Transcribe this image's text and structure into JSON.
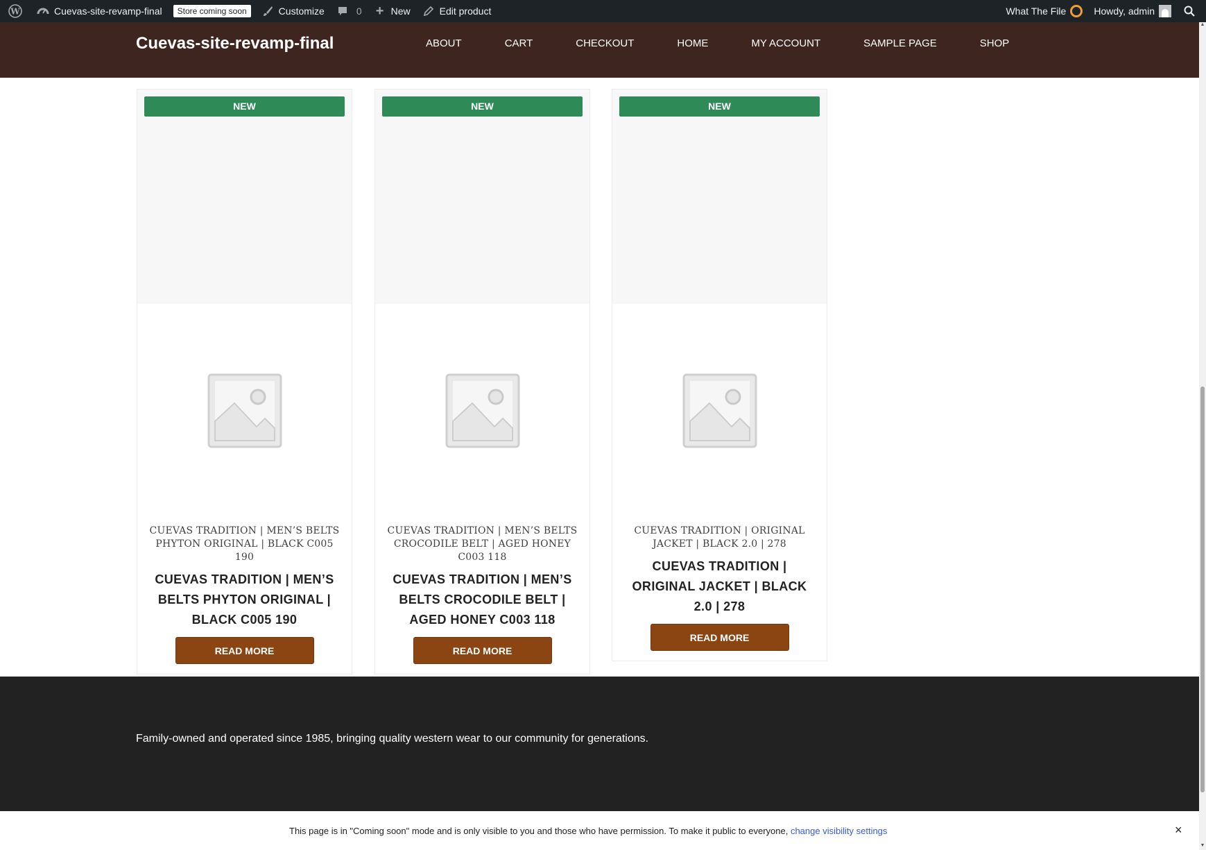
{
  "admin_bar": {
    "site_name": "Cuevas-site-revamp-final",
    "store_badge": "Store coming soon",
    "customize": "Customize",
    "comments_count": "0",
    "new": "New",
    "edit_product": "Edit product",
    "plugin": "What The File",
    "howdy": "Howdy, admin"
  },
  "header": {
    "site_title": "Cuevas-site-revamp-final",
    "nav": [
      "ABOUT",
      "CART",
      "CHECKOUT",
      "HOME",
      "MY ACCOUNT",
      "SAMPLE PAGE",
      "SHOP"
    ]
  },
  "products": [
    {
      "badge": "NEW",
      "category": "CUEVAS TRADITION | MEN’S BELTS PHYTON ORIGINAL | BLACK C005 190",
      "title": "CUEVAS TRADITION | MEN’S BELTS PHYTON ORIGINAL | BLACK C005 190",
      "button": "READ MORE"
    },
    {
      "badge": "NEW",
      "category": "CUEVAS TRADITION | MEN’S BELTS CROCODILE BELT | AGED HONEY C003 118",
      "title": "CUEVAS TRADITION | MEN’S BELTS CROCODILE BELT | AGED HONEY C003 118",
      "button": "READ MORE"
    },
    {
      "badge": "NEW",
      "category": "CUEVAS TRADITION | ORIGINAL JACKET | BLACK 2.0 | 278",
      "title": "CUEVAS TRADITION | ORIGINAL JACKET | BLACK 2.0 | 278",
      "button": "READ MORE"
    }
  ],
  "footer": {
    "text": "Family-owned and operated since 1985, bringing quality western wear to our community for generations."
  },
  "coming_soon": {
    "message": "This page is in \"Coming soon\" mode and is only visible to you and those who have permission. To make it public to everyone,",
    "link": "change visibility settings",
    "close": "×"
  },
  "colors": {
    "admin_bar": "#1d2327",
    "header": "#3f2520",
    "new_badge": "#2e8b57",
    "button": "#8b4513",
    "footer": "#222222",
    "link": "#3858e9"
  }
}
